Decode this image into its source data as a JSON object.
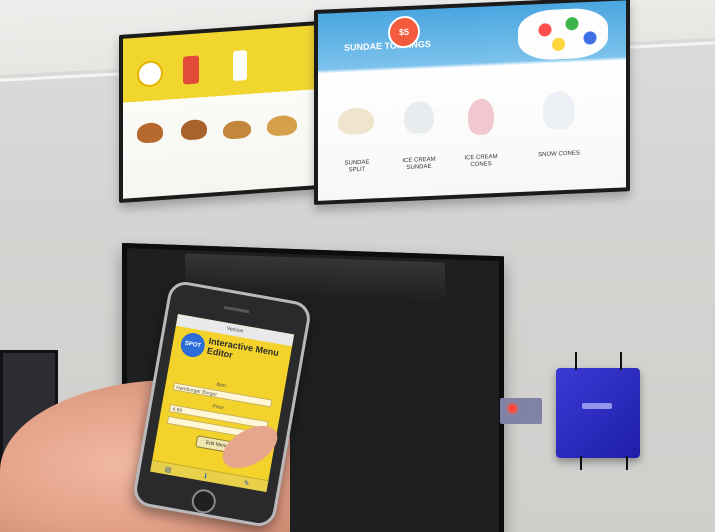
{
  "left_board": {
    "captions": [
      "",
      "",
      "",
      ""
    ]
  },
  "right_board": {
    "headline": "SUNDAE TOPPINGS",
    "price_badge": "$5",
    "captions": [
      "SUNDAE SPLIT",
      "ICE CREAM SUNDAE",
      "ICE CREAM CONES",
      "SNOW CONES"
    ]
  },
  "phone_app": {
    "status_bar": "Verizon",
    "logo_text": "SPOT",
    "title": "Interactive Menu Editor",
    "field1_label": "Item",
    "field1_value": "Hamburger Burger",
    "field2_label": "Price",
    "field2_value": "4.99",
    "button_label": "Edit Menu"
  },
  "colors": {
    "menu_yellow": "#f2d630",
    "menu_blue": "#4aa6e0",
    "player_blue": "#2a2ad0",
    "led_red": "#ff4b3a",
    "app_yellow": "#f3d22c"
  }
}
